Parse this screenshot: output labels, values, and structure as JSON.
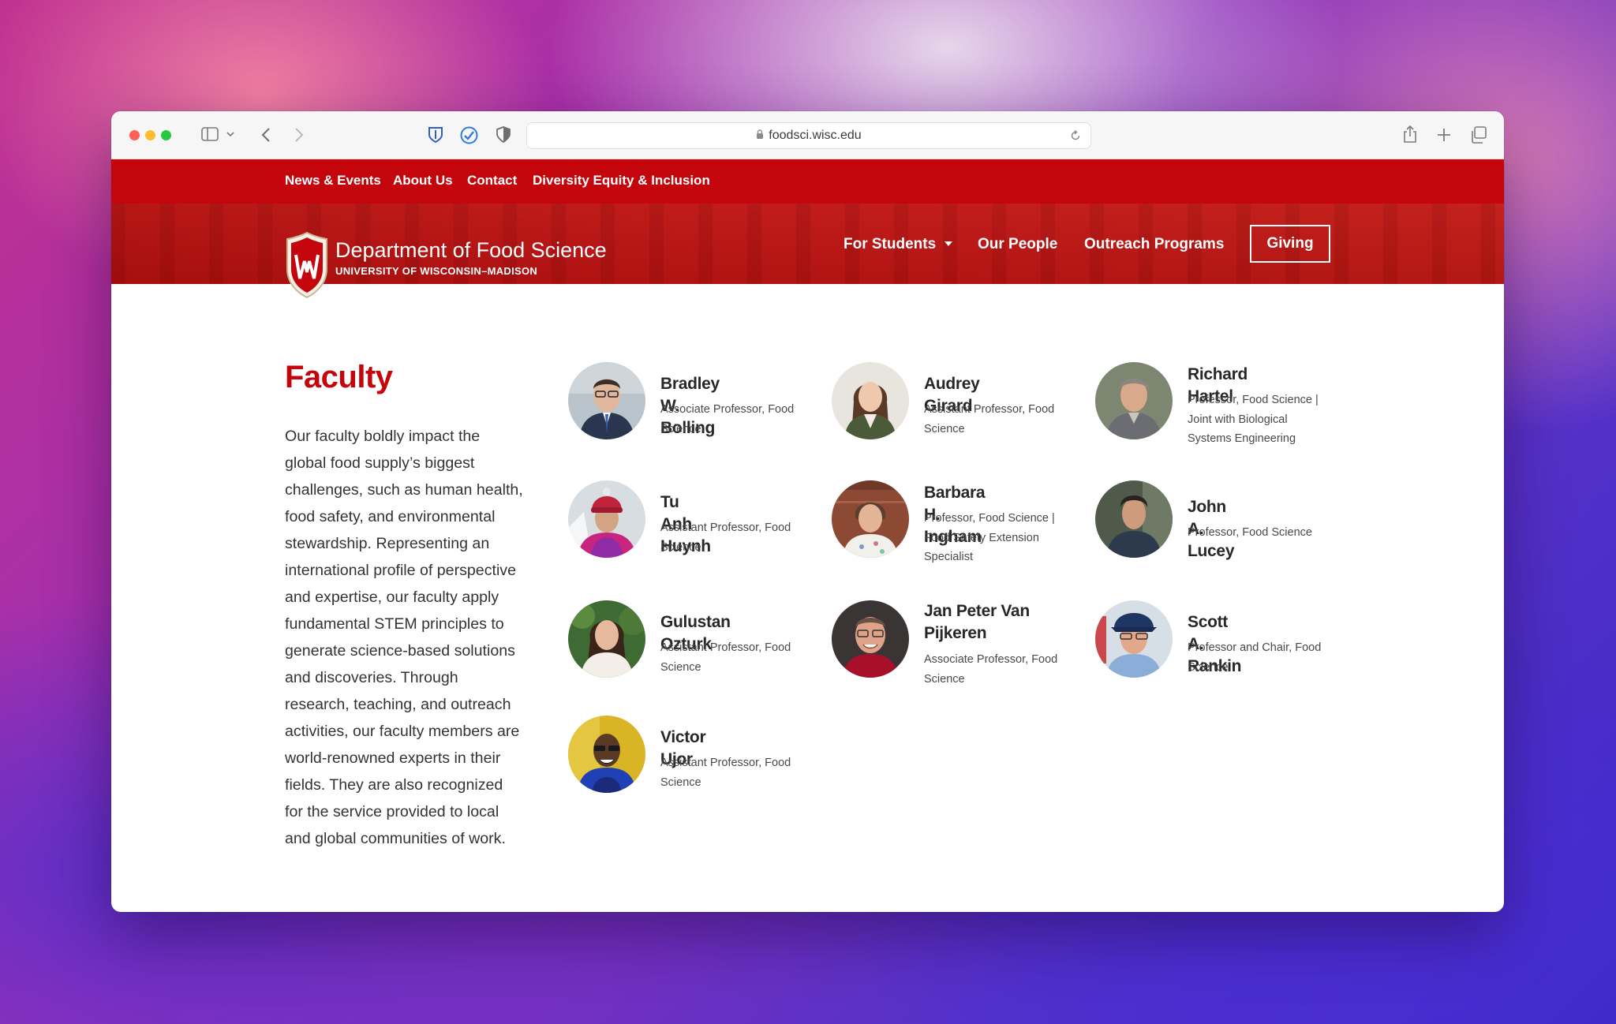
{
  "browser": {
    "url": "foodsci.wisc.edu",
    "icons": [
      "sidebar-icon",
      "chevron-down-icon",
      "back-icon",
      "forward-icon",
      "bitwarden-icon",
      "checkmark-icon",
      "shield-icon",
      "lock-icon",
      "reload-icon",
      "share-icon",
      "plus-icon",
      "tabs-icon"
    ]
  },
  "utility_nav": [
    "News & Events",
    "About Us",
    "Contact",
    "Diversity Equity & Inclusion"
  ],
  "header": {
    "title": "Department of Food Science",
    "subtitle": "UNIVERSITY OF WISCONSIN–MADISON",
    "nav": [
      "For Students",
      "Our People",
      "Outreach Programs"
    ],
    "giving": "Giving"
  },
  "faculty": {
    "heading": "Faculty",
    "intro": "Our faculty boldly impact the global food supply’s biggest challenges, such as human health, food safety, and environmental stewardship. Representing an international profile of perspective and expertise, our faculty apply fundamental STEM principles to generate science-based solutions and discoveries. Through research, teaching, and outreach activities, our faculty members are world-renowned experts in their fields. They are also recognized for the service provided to local and global communities of work.",
    "people": [
      {
        "name": "Bradley W. Bolling",
        "title": "Associate Professor, Food Science"
      },
      {
        "name": "Audrey Girard",
        "title": "Assistant Professor, Food Science"
      },
      {
        "name": "Richard Hartel",
        "title": "Professor, Food Science | Joint with Biological Systems Engineering"
      },
      {
        "name": "Tu Anh Huynh",
        "title": "Assistant Professor, Food Science"
      },
      {
        "name": "Barbara H. Ingham",
        "title": "Professor, Food Science | Food Safety Extension Specialist"
      },
      {
        "name": "John A. Lucey",
        "title": "Professor, Food Science"
      },
      {
        "name": "Gulustan Ozturk",
        "title": "Assistant Professor, Food Science"
      },
      {
        "name": "Jan Peter Van Pijkeren",
        "title": "Associate Professor, Food Science"
      },
      {
        "name": "Scott A. Rankin",
        "title": "Professor and Chair, Food Science"
      },
      {
        "name": "Victor Ujor",
        "title": "Assistant Professor, Food Science"
      }
    ]
  }
}
